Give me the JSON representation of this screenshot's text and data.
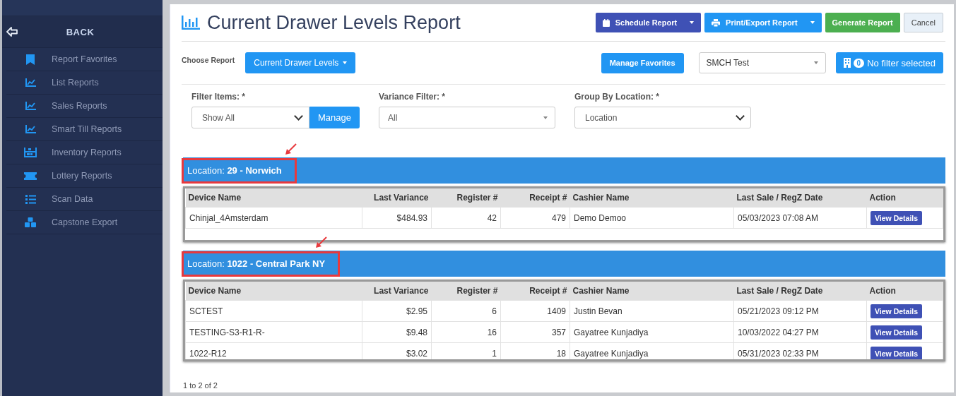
{
  "sidebar": {
    "back_label": "BACK",
    "items": [
      {
        "label": "Report Favorites"
      },
      {
        "label": "List Reports"
      },
      {
        "label": "Sales Reports"
      },
      {
        "label": "Smart Till Reports"
      },
      {
        "label": "Inventory Reports"
      },
      {
        "label": "Lottery Reports"
      },
      {
        "label": "Scan Data"
      },
      {
        "label": "Capstone Export"
      }
    ]
  },
  "header": {
    "title": "Current Drawer Levels Report",
    "buttons": [
      {
        "label": "Schedule Report",
        "kind": "schedule"
      },
      {
        "label": "Print/Export Report",
        "kind": "export"
      },
      {
        "label": "Generate Report",
        "kind": "generate"
      },
      {
        "label": "Cancel",
        "kind": "cancel"
      }
    ]
  },
  "report_bar": {
    "choose_label": "Choose Report",
    "report_button": "Current Drawer Levels",
    "favorites_button": "Manage Favorites",
    "store_select": "SMCH Test",
    "filter_count": "0",
    "filter_label": "No filter selected"
  },
  "filters": [
    {
      "label": "Filter Items: *",
      "value": "Show All",
      "kind": "native",
      "button": "Manage"
    },
    {
      "label": "Variance Filter: *",
      "value": "All",
      "kind": "chosen"
    },
    {
      "label": "Group By Location: *",
      "value": "Location",
      "kind": "native"
    }
  ],
  "groups": [
    {
      "title": "Location: **29 - Norwich**",
      "highlighted": true,
      "columns": [
        "Device Name",
        "Last Variance",
        "Register #",
        "Receipt #",
        "Cashier Name",
        "Last Sale / RegZ Date",
        "Action"
      ],
      "rows": [
        {
          "cells": [
            "Chinjal_4Amsterdam",
            "$484.93",
            "42",
            "479",
            "Demo Demoo",
            "05/03/2023 07:08 AM"
          ],
          "action": "View Details"
        }
      ]
    },
    {
      "title": "Location: **1022 - Central Park NY**",
      "highlighted": true,
      "columns": [
        "Device Name",
        "Last Variance",
        "Register #",
        "Receipt #",
        "Cashier Name",
        "Last Sale / RegZ Date",
        "Action"
      ],
      "rows": [
        {
          "cells": [
            "SCTEST",
            "$2.95",
            "6",
            "1409",
            "Justin Bevan",
            "05/21/2023 09:12 PM"
          ],
          "action": "View Details"
        },
        {
          "cells": [
            "TESTING-S3-R1-R-",
            "$9.48",
            "16",
            "357",
            "Gayatree Kunjadiya",
            "10/03/2022 04:27 PM"
          ],
          "action": "View Details"
        },
        {
          "cells": [
            "1022-R12",
            "$3.02",
            "1",
            "18",
            "Gayatree Kunjadiya",
            "05/31/2023 02:33 PM"
          ],
          "action": "View Details"
        }
      ]
    }
  ],
  "footer": "1 to 2 of 2"
}
